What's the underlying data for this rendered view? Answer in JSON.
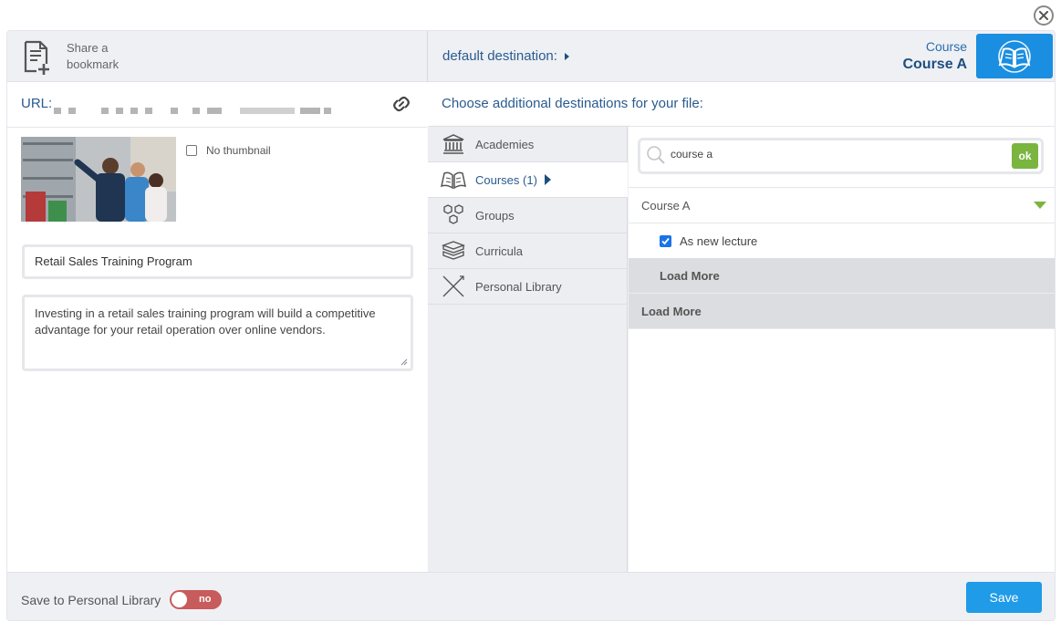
{
  "header": {
    "share_line1": "Share a",
    "share_line2": "bookmark",
    "default_destination": "default destination:",
    "course_kind": "Course",
    "course_name": "Course A"
  },
  "left": {
    "url_label": "URL:",
    "no_thumbnail_label": "No thumbnail",
    "title_value": "Retail Sales Training Program",
    "description_value": "Investing in a retail sales training program will build a competitive advantage for your retail operation over online vendors."
  },
  "right": {
    "choose_title": "Choose additional destinations for your file:",
    "categories": [
      {
        "label": "Academies",
        "icon": "institution-icon"
      },
      {
        "label": "Courses (1)",
        "icon": "open-book-icon"
      },
      {
        "label": "Groups",
        "icon": "hexagons-icon"
      },
      {
        "label": "Curricula",
        "icon": "stacked-books-icon"
      },
      {
        "label": "Personal Library",
        "icon": "crossed-pens-icon"
      }
    ],
    "search_value": "course a",
    "ok_label": "ok",
    "course_item": "Course A",
    "lecture_option": "As new lecture",
    "load_more_inner": "Load More",
    "load_more_outer": "Load More"
  },
  "footer": {
    "save_personal_library": "Save to Personal Library",
    "toggle_state": "no",
    "save_label": "Save"
  },
  "colors": {
    "accent_blue": "#1f9be8",
    "ok_green": "#7ab540",
    "toggle_red": "#c85b5b",
    "heading_blue": "#2a5b8f"
  }
}
